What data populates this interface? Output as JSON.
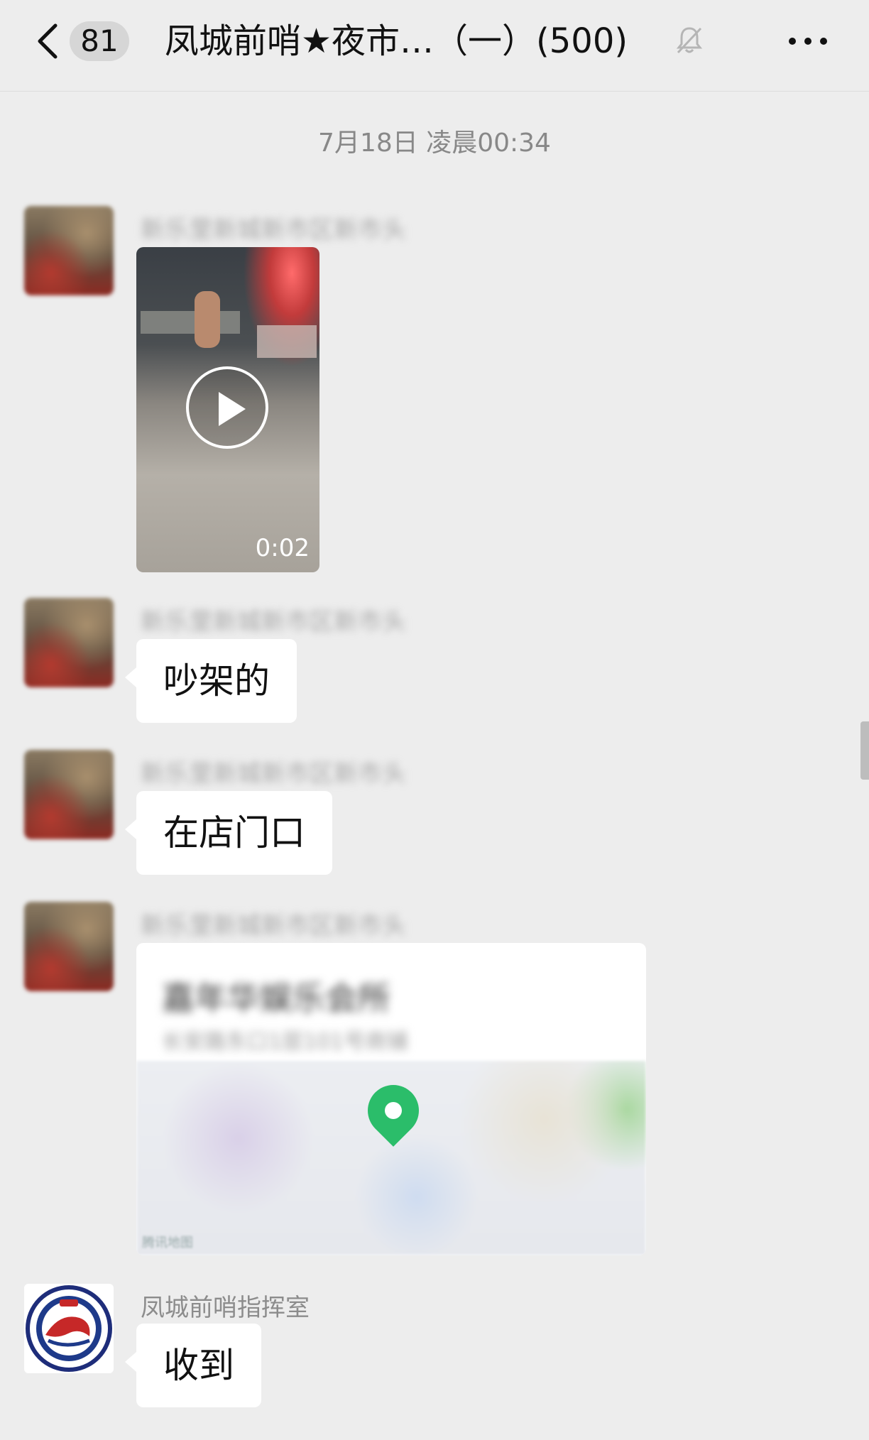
{
  "header": {
    "unread_count": "81",
    "title": "凤城前哨★夜市…（一）(500)"
  },
  "time_divider": "7月18日 凌晨00:34",
  "messages": [
    {
      "type": "video",
      "sender": "新乐里新城新市区新市头",
      "duration": "0:02"
    },
    {
      "type": "text",
      "sender": "新乐里新城新市区新市头",
      "text": "吵架的"
    },
    {
      "type": "text",
      "sender": "新乐里新城新市区新市头",
      "text": "在店门口"
    },
    {
      "type": "location",
      "sender": "新乐里新城新市区新市头",
      "place_name": "嘉年华娱乐会所",
      "address": "长安路东口1层101号商铺",
      "map_label": "腾讯地图"
    },
    {
      "type": "text",
      "sender": "凤城前哨指挥室",
      "text": "收到"
    }
  ],
  "colors": {
    "background": "#ededed",
    "bubble": "#ffffff",
    "map_pin": "#2bbd6a"
  }
}
